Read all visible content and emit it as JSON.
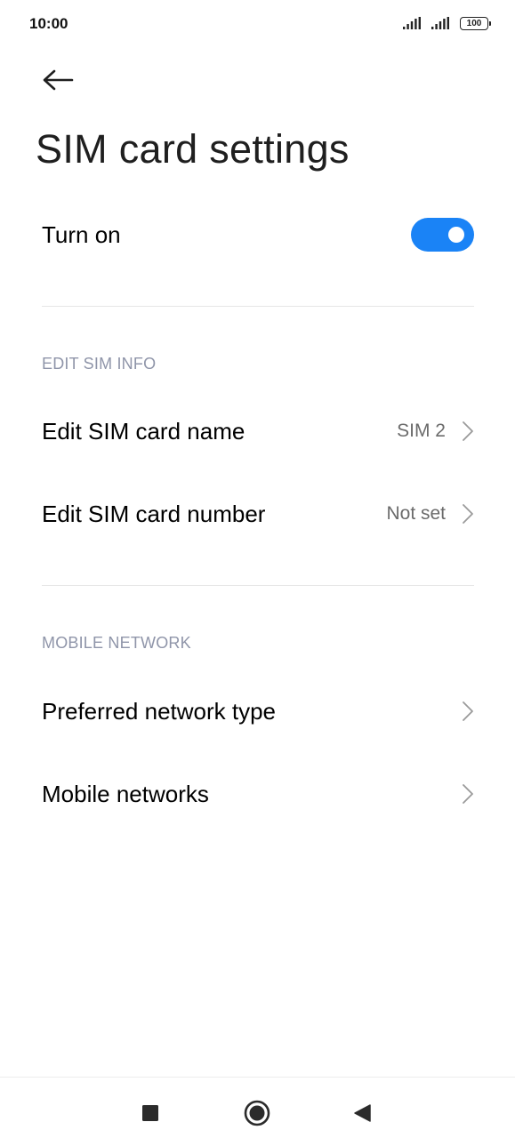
{
  "status_bar": {
    "time": "10:00",
    "battery": "100"
  },
  "header": {
    "back_icon": "arrow-left-icon",
    "title": "SIM card settings"
  },
  "toggle_row": {
    "label": "Turn on",
    "state": true,
    "accent_color": "#1a83f6"
  },
  "sections": {
    "edit_sim_info": {
      "title": "EDIT SIM INFO",
      "items": [
        {
          "label": "Edit SIM card name",
          "value": "SIM 2"
        },
        {
          "label": "Edit SIM card number",
          "value": "Not set"
        }
      ]
    },
    "mobile_network": {
      "title": "MOBILE NETWORK",
      "items": [
        {
          "label": "Preferred network type"
        },
        {
          "label": "Mobile networks"
        }
      ]
    }
  },
  "nav_bar": {
    "recents_icon": "square-icon",
    "home_icon": "circle-icon",
    "back_icon": "triangle-back-icon"
  }
}
